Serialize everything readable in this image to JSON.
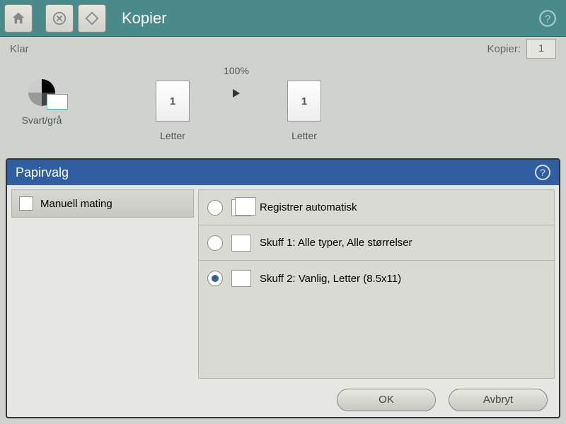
{
  "topbar": {
    "title": "Kopier"
  },
  "status": {
    "left": "Klar",
    "copies_label": "Kopier:",
    "copies_value": "1"
  },
  "preview": {
    "color_label": "Svart/grå",
    "src_label": "Letter",
    "scale": "100%",
    "dst_label": "Letter",
    "page_num": "1"
  },
  "dialog": {
    "title": "Papirvalg",
    "manual_feed": "Manuell mating",
    "trays": [
      {
        "label": "Registrer automatisk",
        "selected": false,
        "stackIcon": true
      },
      {
        "label": "Skuff 1: Alle typer, Alle størrelser",
        "selected": false,
        "stackIcon": false
      },
      {
        "label": "Skuff 2: Vanlig, Letter (8.5x11)",
        "selected": true,
        "stackIcon": false
      }
    ],
    "ok": "OK",
    "cancel": "Avbryt"
  }
}
